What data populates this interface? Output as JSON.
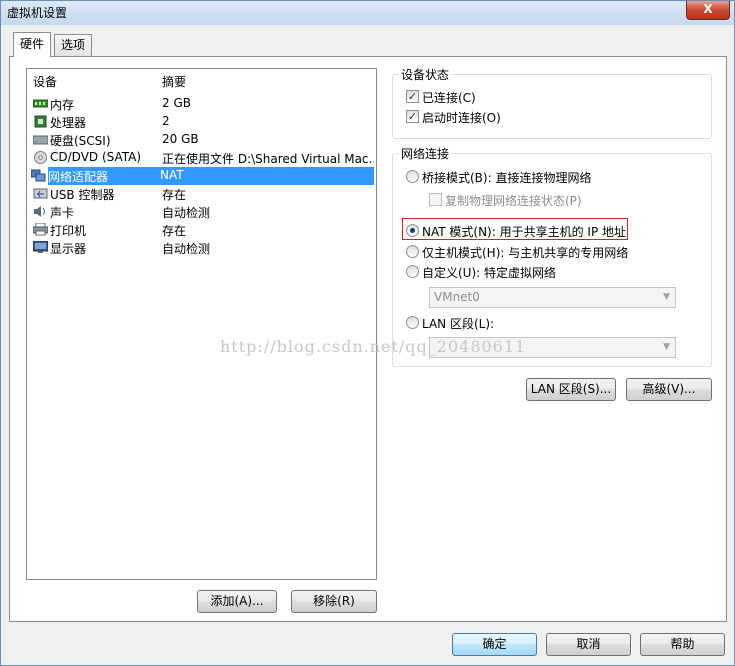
{
  "window": {
    "title": "虚拟机设置",
    "close_label": "X"
  },
  "tabs": [
    {
      "label": "硬件",
      "active": true
    },
    {
      "label": "选项",
      "active": false
    }
  ],
  "devices": {
    "col_device": "设备",
    "col_summary": "摘要",
    "rows": [
      {
        "name": "内存",
        "summary": "2 GB",
        "icon": "memory-icon"
      },
      {
        "name": "处理器",
        "summary": "2",
        "icon": "cpu-icon"
      },
      {
        "name": "硬盘(SCSI)",
        "summary": "20 GB",
        "icon": "hard-disk-icon"
      },
      {
        "name": "CD/DVD (SATA)",
        "summary": "正在使用文件 D:\\Shared Virtual Mac...",
        "icon": "cd-dvd-icon"
      },
      {
        "name": "网络适配器",
        "summary": "NAT",
        "icon": "network-adapter-icon",
        "selected": true
      },
      {
        "name": "USB 控制器",
        "summary": "存在",
        "icon": "usb-icon"
      },
      {
        "name": "声卡",
        "summary": "自动检测",
        "icon": "sound-card-icon"
      },
      {
        "name": "打印机",
        "summary": "存在",
        "icon": "printer-icon"
      },
      {
        "name": "显示器",
        "summary": "自动检测",
        "icon": "monitor-icon"
      }
    ],
    "add_label": "添加(A)...",
    "remove_label": "移除(R)"
  },
  "device_status": {
    "legend": "设备状态",
    "connected_label": "已连接(C)",
    "connected": true,
    "connect_on_power_label": "启动时连接(O)",
    "connect_on_power": true
  },
  "network": {
    "legend": "网络连接",
    "bridged_label": "桥接模式(B): 直接连接物理网络",
    "replicate_label": "复制物理网络连接状态(P)",
    "nat_label": "NAT 模式(N): 用于共享主机的 IP 地址",
    "hostonly_label": "仅主机模式(H): 与主机共享的专用网络",
    "custom_label": "自定义(U): 特定虚拟网络",
    "custom_value": "VMnet0",
    "lan_label": "LAN 区段(L):",
    "lan_value": "",
    "selected_mode": "nat"
  },
  "actions": {
    "lan_segments_label": "LAN 区段(S)...",
    "advanced_label": "高级(V)..."
  },
  "footer": {
    "ok_label": "确定",
    "cancel_label": "取消",
    "help_label": "帮助"
  },
  "watermark": "http://blog.csdn.net/qq_20480611",
  "colors": {
    "selection": "#3399ff",
    "highlight_box": "#d92020"
  }
}
